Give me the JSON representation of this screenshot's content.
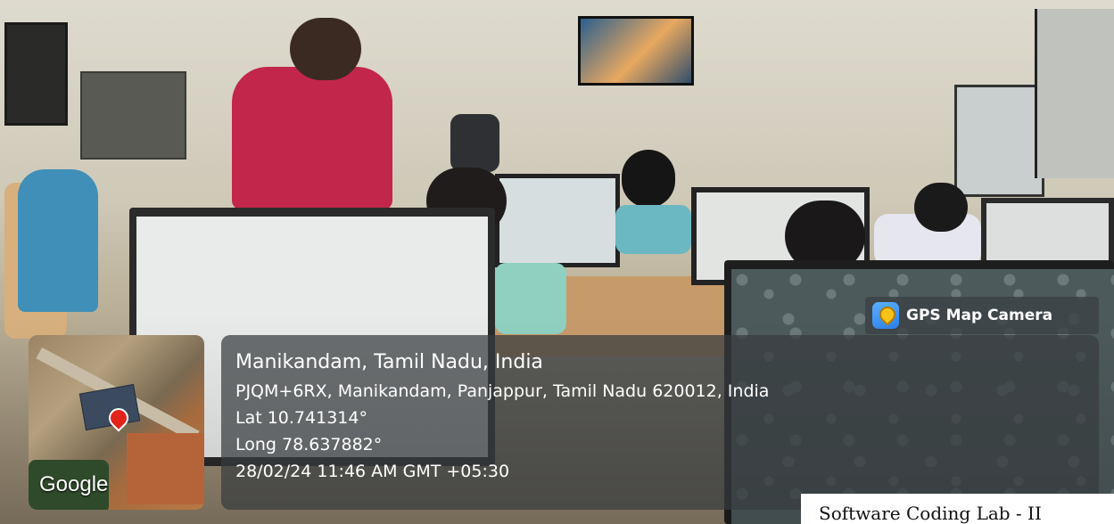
{
  "gps_badge": {
    "title": "GPS Map Camera",
    "icon": "map-pin-camera-icon"
  },
  "map": {
    "attribution": "Google",
    "pin_color": "#e3241b"
  },
  "location": {
    "place": "Manikandam, Tamil Nadu, India",
    "address": "PJQM+6RX, Manikandam, Panjappur, Tamil Nadu 620012, India",
    "latitude": "Lat 10.741314°",
    "longitude": "Long 78.637882°",
    "timestamp": "28/02/24 11:46 AM GMT +05:30"
  },
  "caption": {
    "text": "Software Coding Lab - II"
  },
  "colors": {
    "overlay": "#373c3e",
    "text": "#ffffff"
  }
}
